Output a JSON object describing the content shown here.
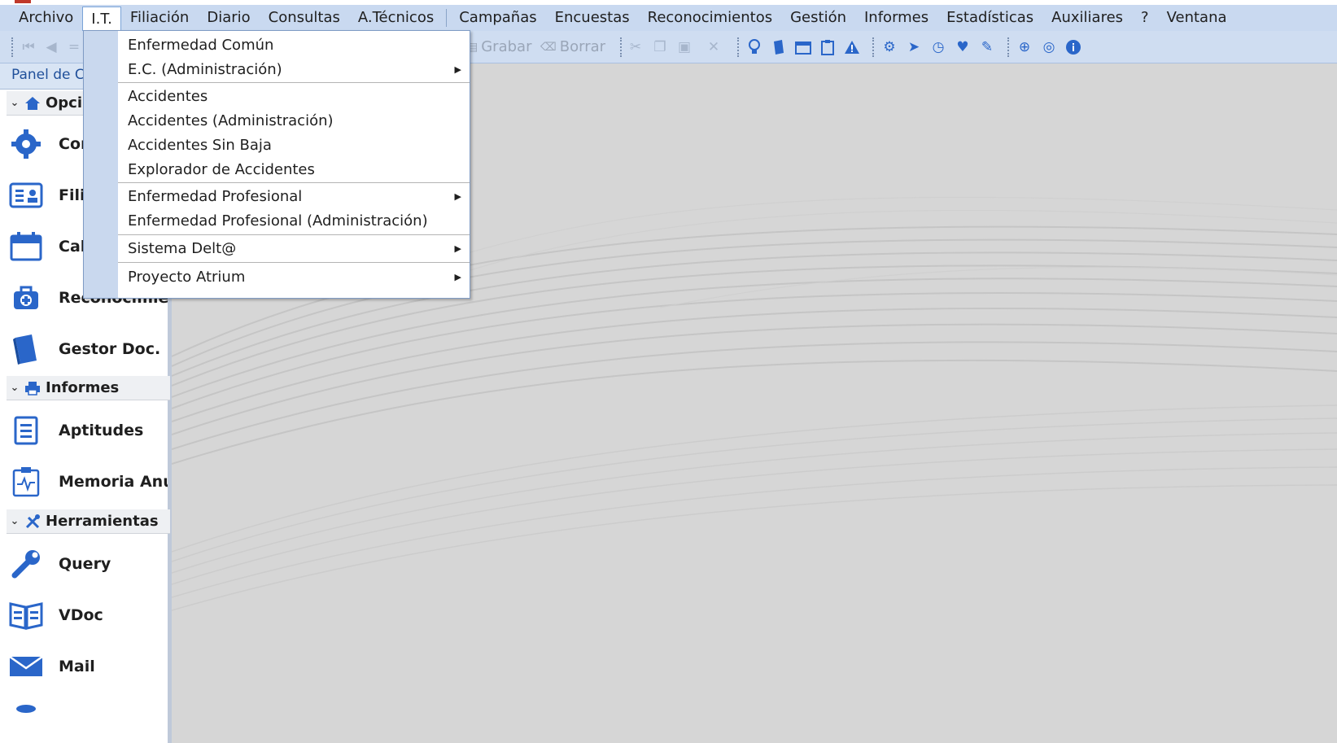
{
  "menubar": {
    "items": [
      "Archivo",
      "I.T.",
      "Filiación",
      "Diario",
      "Consultas",
      "A.Técnicos",
      "Campañas",
      "Encuestas",
      "Reconocimientos",
      "Gestión",
      "Informes",
      "Estadísticas",
      "Auxiliares",
      "?",
      "Ventana"
    ],
    "active": "I.T."
  },
  "toolbar": {
    "save_label": "Grabar",
    "delete_label": "Borrar"
  },
  "sidebar": {
    "panel_title": "Panel de C",
    "groups": [
      {
        "label": "Opciones",
        "visible_label": "Opci"
      },
      {
        "label": "Informes"
      },
      {
        "label": "Herramientas"
      }
    ],
    "items": [
      {
        "label": "Cor"
      },
      {
        "label": "Fili"
      },
      {
        "label": "Cal"
      },
      {
        "label": "Reconocimien"
      },
      {
        "label": "Gestor Doc."
      },
      {
        "label": "Aptitudes"
      },
      {
        "label": "Memoria Anu"
      },
      {
        "label": "Query"
      },
      {
        "label": "VDoc"
      },
      {
        "label": "Mail"
      }
    ]
  },
  "dropdown": {
    "items": [
      {
        "label": "Enfermedad Común",
        "submenu": false
      },
      {
        "label": "E.C. (Administración)",
        "submenu": true
      },
      {
        "label": "Accidentes",
        "submenu": false
      },
      {
        "label": "Accidentes (Administración)",
        "submenu": false
      },
      {
        "label": "Accidentes Sin Baja",
        "submenu": false
      },
      {
        "label": "Explorador de Accidentes",
        "submenu": false
      },
      {
        "label": "Enfermedad Profesional",
        "submenu": true
      },
      {
        "label": "Enfermedad Profesional (Administración)",
        "submenu": false
      },
      {
        "label": "Sistema Delt@",
        "submenu": true
      },
      {
        "label": "Proyecto Atrium",
        "submenu": true
      }
    ]
  },
  "colors": {
    "menubar_bg": "#c9d9f0",
    "accent_blue": "#2a66c9",
    "workspace_bg": "#d6d6d6"
  }
}
